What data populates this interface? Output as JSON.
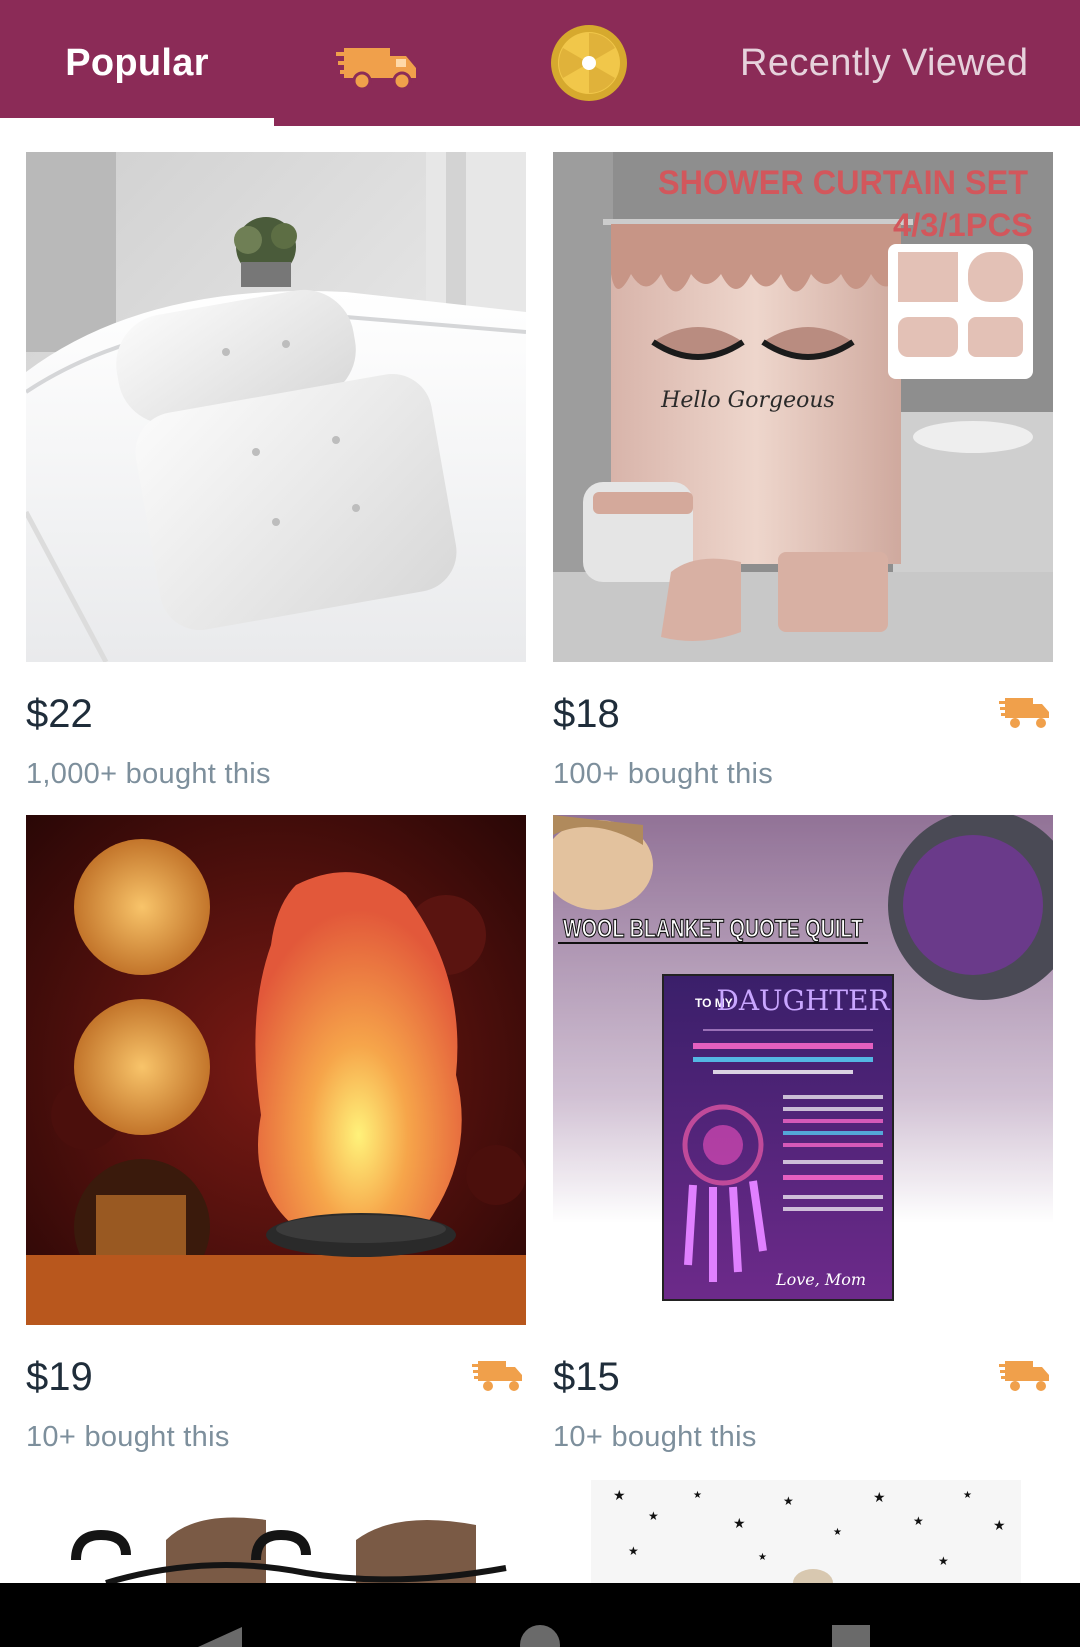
{
  "tabs": {
    "popular": "Popular",
    "shipping_icon": "delivery-truck-icon",
    "coin_icon": "coin-wheel-icon",
    "recently_viewed": "Recently Viewed"
  },
  "colors": {
    "header_bg": "#8b2b57",
    "truck_orange": "#f0a04b",
    "price_text": "#1f2d3a",
    "bought_text": "#7d8f9c"
  },
  "products": [
    {
      "price": "$22",
      "bought": "1,000+ bought this",
      "fast_shipping": false,
      "image_text": []
    },
    {
      "price": "$18",
      "bought": "100+ bought this",
      "fast_shipping": true,
      "image_text": [
        "SHOWER CURTAIN SET",
        "4/3/1PCS",
        "Hello Gorgeous"
      ]
    },
    {
      "price": "$19",
      "bought": "10+ bought this",
      "fast_shipping": true,
      "image_text": []
    },
    {
      "price": "$15",
      "bought": "10+ bought this",
      "fast_shipping": true,
      "image_text": [
        "WOOL BLANKET QUOTE QUILT",
        "TO MY",
        "DAUGHTER",
        "Love, Mom"
      ]
    }
  ]
}
